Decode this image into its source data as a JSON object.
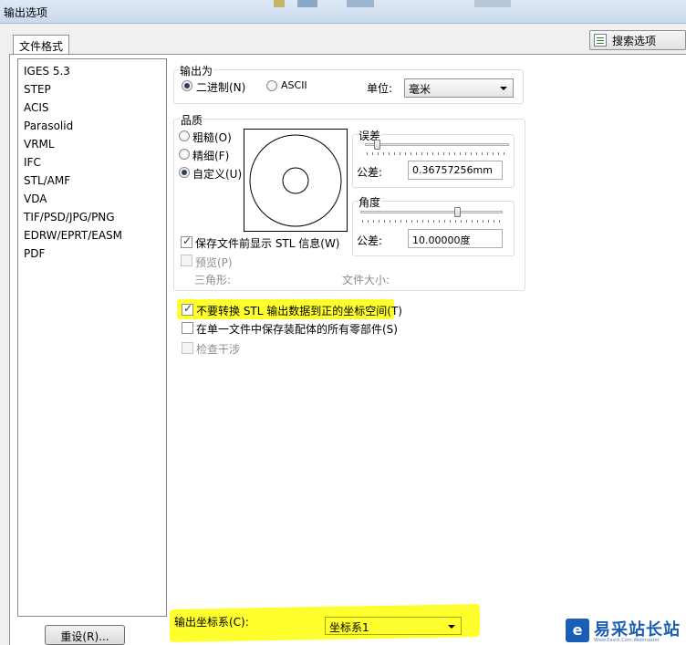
{
  "window": {
    "title": "输出选项"
  },
  "search": {
    "label": "搜索选项"
  },
  "tab": {
    "label": "文件格式"
  },
  "formats": [
    "IGES 5.3",
    "STEP",
    "ACIS",
    "Parasolid",
    "VRML",
    "IFC",
    "STL/AMF",
    "VDA",
    "TIF/PSD/JPG/PNG",
    "EDRW/EPRT/EASM",
    "PDF"
  ],
  "selected_format": "STL/AMF",
  "output_as": {
    "legend": "输出为",
    "binary_label": "二进制(N)",
    "ascii_label": "ASCII",
    "selected": "binary",
    "unit_label": "单位:",
    "unit_value": "毫米"
  },
  "quality": {
    "legend": "品质",
    "coarse_label": "粗糙(O)",
    "fine_label": "精细(F)",
    "custom_label": "自定义(U)",
    "selected": "custom",
    "deviation": {
      "legend": "误差",
      "tolerance_label": "公差:",
      "tolerance_value": "0.36757256mm",
      "slider_level": 0.08
    },
    "angle": {
      "legend": "角度",
      "tolerance_label": "公差:",
      "tolerance_value": "10.00000度",
      "slider_level": 0.68
    },
    "show_info_label": "保存文件前显示 STL 信息(W)",
    "show_info_checked": true,
    "preview_label": "预览(P)",
    "triangles_label": "三角形:",
    "filesize_label": "文件大小:"
  },
  "options": {
    "no_transform_label": "不要转换 STL 输出数据到正的坐标空间(T)",
    "no_transform_checked": true,
    "single_file_label": "在单一文件中保存装配体的所有零部件(S)",
    "single_file_checked": false,
    "interference_label": "检查干涉"
  },
  "coord": {
    "label": "输出坐标系(C):",
    "value": "坐标系1"
  },
  "buttons": {
    "reset": "重设(R)..."
  },
  "watermark": {
    "logo": "e",
    "text": "易采站长站",
    "sub": "Www.Easck.Com Webmaster"
  },
  "colors": {
    "highlight": "#ffff2e",
    "selection_dot": "#2f3e59",
    "watermark_blue": "#1a5eb6"
  }
}
